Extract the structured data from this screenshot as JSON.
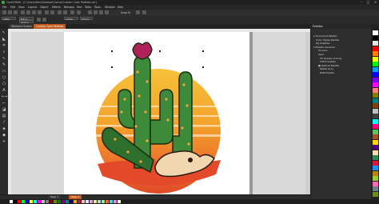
{
  "window": {
    "title": "CorelDRAW - [C:\\Users\\Dev\\Desktop\\Cactus\\Custom Color Palettes.cdr]"
  },
  "menu": [
    "File",
    "Edit",
    "View",
    "Layout",
    "Object",
    "Effects",
    "Bitmaps",
    "Text",
    "Table",
    "Tools",
    "Window",
    "Help"
  ],
  "toolbar": {
    "zoom": "Snap To"
  },
  "propbar": {
    "preset": "Letter",
    "width": "8.5 in",
    "height": "11.0 in",
    "units": "inches",
    "nudge": "0.01 in"
  },
  "tabs": {
    "welcome": "Welcome Screen",
    "document": "Custom Color Palettes"
  },
  "pages": {
    "page1": "Page 1",
    "page2": "Page 2"
  },
  "docker": {
    "title": "Palettes",
    "items": [
      "Document Palette",
      "Color Styles Palette",
      "My Palettes",
      "Palette Libraries",
      "Process",
      "Spot",
      "50 shades of Gray",
      "CMYK Palette",
      "Default Palette",
      "Pastel Gray",
      "RGB Palette"
    ]
  },
  "colors": {
    "accent": "#e7a21a",
    "palette": [
      "#ffffff",
      "#000000",
      "#e6e6e6",
      "#ff0000",
      "#ff7f00",
      "#ffff00",
      "#00ff00",
      "#00a0ff",
      "#0000ff",
      "#8000ff",
      "#ff00ff",
      "#ff8080",
      "#808000",
      "#008080",
      "#804000",
      "#c0c0c0",
      "#404040",
      "#00ffff",
      "#ff0080",
      "#60c060",
      "#a0522d",
      "#ffd700",
      "#4b0082",
      "#f5deb3",
      "#2e8b57",
      "#dc143c",
      "#1e90ff",
      "#b8860b",
      "#9acd32",
      "#ff69b4",
      "#708090",
      "#6b8e23"
    ],
    "bottom": [
      "#ffffff",
      "#000000",
      "#ff0000",
      "#00ff00",
      "#0000ff",
      "#ffff00",
      "#00ffff",
      "#ff00ff",
      "#c0c0c0",
      "#808080",
      "#800000",
      "#808000",
      "#008000",
      "#800080",
      "#008080",
      "#000080",
      "#ffa500",
      "#a52a2a",
      "#ffc0cb",
      "#e6e6fa",
      "#dda0dd",
      "#f0e68c",
      "#add8e6",
      "#90ee90",
      "#ff6347",
      "#40e0d0",
      "#ee82ee",
      "#f5f5dc"
    ]
  }
}
